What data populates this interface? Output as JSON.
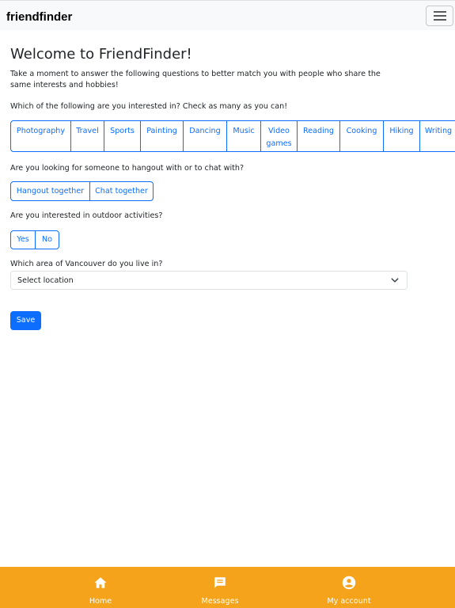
{
  "app": {
    "brand": "friendfinder"
  },
  "header": {
    "title": "Welcome to FriendFinder!"
  },
  "intro": "Take a moment to answer the following questions to better match you with people who share the same interests and hobbies!",
  "interests": {
    "question": "Which of the following are you interested in? Check as many as you can!",
    "options": [
      "Photography",
      "Travel",
      "Sports",
      "Painting",
      "Dancing",
      "Music",
      "Video games",
      "Reading",
      "Cooking",
      "Hiking",
      "Writing"
    ]
  },
  "hangout": {
    "question": "Are you looking for someone to hangout with or to chat with?",
    "options": [
      "Hangout together",
      "Chat together"
    ]
  },
  "outdoor": {
    "question": "Are you interested in outdoor activities?",
    "options": [
      "Yes",
      "No"
    ]
  },
  "location": {
    "question": "Which area of Vancouver do you live in?",
    "selected": "Select location"
  },
  "actions": {
    "save_label": "Save"
  },
  "bottom_nav": {
    "items": [
      {
        "label": "Home",
        "icon": "home-icon"
      },
      {
        "label": "Messages",
        "icon": "message-icon"
      },
      {
        "label": "My account",
        "icon": "account-icon"
      }
    ]
  },
  "colors": {
    "primary": "#0d6efd",
    "bottom_bar": "#f5a31a",
    "navbar": "#f8f9fa"
  }
}
